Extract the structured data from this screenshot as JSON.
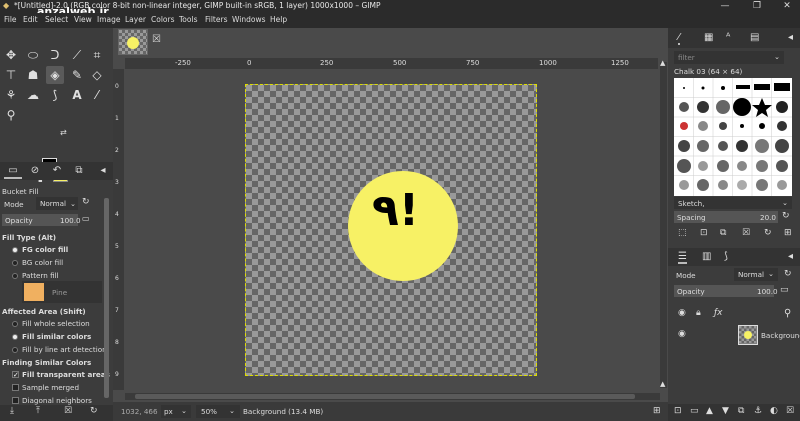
{
  "window": {
    "title": "*[Untitled]-2.0 (RGB color 8-bit non-linear integer, GIMP built-in sRGB, 1 layer) 1000x1000 – GIMP",
    "watermark": "anzalweb.ir"
  },
  "menus": [
    "File",
    "Edit",
    "Select",
    "View",
    "Image",
    "Layer",
    "Colors",
    "Tools",
    "Filters",
    "Windows",
    "Help"
  ],
  "colors": {
    "foreground": "#000000",
    "background": "#f7f165",
    "canvas_fill": "#f7f165"
  },
  "tool_options": {
    "title": "Bucket Fill",
    "mode_label": "Mode",
    "mode_value": "Normal",
    "opacity_label": "Opacity",
    "opacity_value": "100.0",
    "fill_type_label": "Fill Type (Alt)",
    "fill_types": [
      "FG color fill",
      "BG color fill",
      "Pattern fill"
    ],
    "pattern_name": "Pine",
    "affected_area_label": "Affected Area (Shift)",
    "affected_areas": [
      "Fill whole selection",
      "Fill similar colors",
      "Fill by line art detection"
    ],
    "finding_label": "Finding Similar Colors",
    "finding_options": [
      "Fill transparent areas",
      "Sample merged",
      "Diagonal neighbors"
    ]
  },
  "ruler": {
    "h": [
      "-250",
      "0",
      "250",
      "500",
      "750",
      "1000",
      "1250"
    ],
    "v": [
      "0",
      "1",
      "2",
      "3",
      "4",
      "5",
      "6",
      "7",
      "8",
      "9"
    ]
  },
  "canvas": {
    "text": "۹!"
  },
  "status": {
    "coords": "1032, 466",
    "unit": "px",
    "zoom": "50%",
    "layer": "Background (13.4 MB)"
  },
  "brushes": {
    "filter_placeholder": "filter",
    "current": "Chalk 03 (64 × 64)",
    "tag": "Sketch,",
    "spacing_label": "Spacing",
    "spacing_value": "20.0"
  },
  "layers": {
    "mode_label": "Mode",
    "mode_value": "Normal",
    "opacity_label": "Opacity",
    "opacity_value": "100.0",
    "layer_name": "Background"
  }
}
